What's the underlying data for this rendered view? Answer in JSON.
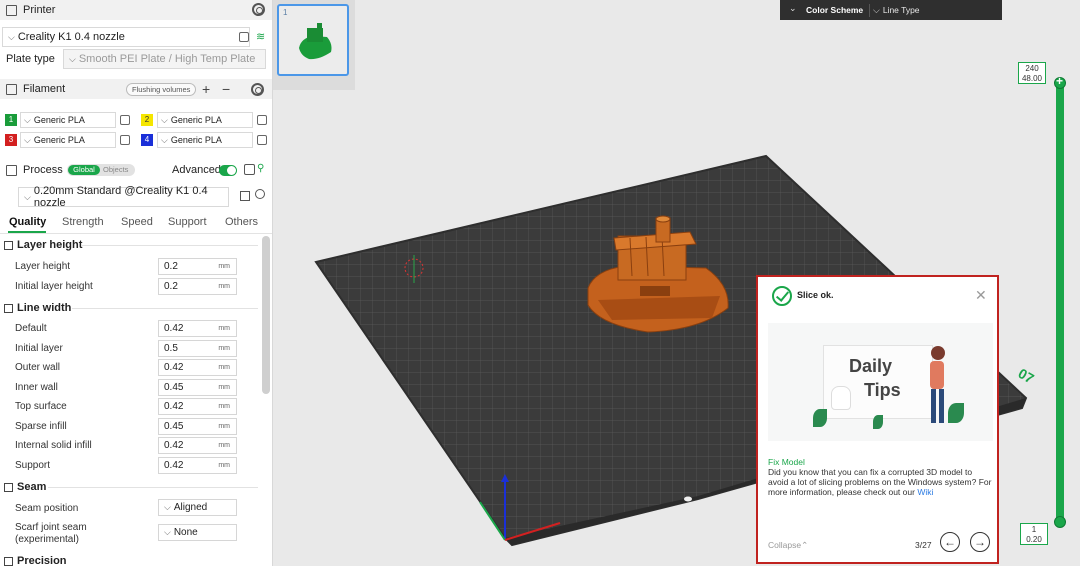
{
  "printer": {
    "title": "Printer",
    "selected_printer": "Creality K1 0.4 nozzle",
    "plate_type_label": "Plate type",
    "plate_type_value": "Smooth PEI Plate / High Temp Plate"
  },
  "filament": {
    "title": "Filament",
    "flushing_volumes_label": "Flushing volumes",
    "add_symbol": "+",
    "remove_symbol": "−",
    "slots": [
      {
        "number": "1",
        "color": "#1a9c3a",
        "name": "Generic PLA"
      },
      {
        "number": "2",
        "color": "#f5e600",
        "name": "Generic PLA"
      },
      {
        "number": "3",
        "color": "#d32020",
        "name": "Generic PLA"
      },
      {
        "number": "4",
        "color": "#1a2fd8",
        "name": "Generic PLA"
      }
    ]
  },
  "process": {
    "title": "Process",
    "scope_global": "Global",
    "scope_objects": "Objects",
    "advanced_label": "Advanced",
    "preset": "0.20mm Standard @Creality K1 0.4 nozzle",
    "tabs": [
      "Quality",
      "Strength",
      "Speed",
      "Support",
      "Others"
    ],
    "groups": {
      "layer_height": {
        "title": "Layer height",
        "rows": [
          {
            "label": "Layer height",
            "value": "0.2",
            "unit": "mm"
          },
          {
            "label": "Initial layer height",
            "value": "0.2",
            "unit": "mm"
          }
        ]
      },
      "line_width": {
        "title": "Line width",
        "rows": [
          {
            "label": "Default",
            "value": "0.42",
            "unit": "mm"
          },
          {
            "label": "Initial layer",
            "value": "0.5",
            "unit": "mm"
          },
          {
            "label": "Outer wall",
            "value": "0.42",
            "unit": "mm"
          },
          {
            "label": "Inner wall",
            "value": "0.45",
            "unit": "mm"
          },
          {
            "label": "Top surface",
            "value": "0.42",
            "unit": "mm"
          },
          {
            "label": "Sparse infill",
            "value": "0.45",
            "unit": "mm"
          },
          {
            "label": "Internal solid infill",
            "value": "0.42",
            "unit": "mm"
          },
          {
            "label": "Support",
            "value": "0.42",
            "unit": "mm"
          }
        ]
      },
      "seam": {
        "title": "Seam",
        "rows": [
          {
            "label": "Seam position",
            "value": "Aligned"
          },
          {
            "label": "Scarf joint seam (experimental)",
            "value": "None"
          }
        ]
      },
      "precision": {
        "title": "Precision"
      }
    }
  },
  "plate": {
    "thumbnail_number": "1"
  },
  "color_scheme": {
    "label": "Color Scheme",
    "value": "Line Type"
  },
  "layer_slider": {
    "top_layer": "240",
    "top_height": "48.00",
    "bottom_layer": "1",
    "bottom_height": "0.20"
  },
  "plate_label": "07",
  "notification": {
    "status": "Slice ok.",
    "tip_image_line1": "Daily",
    "tip_image_line2": "Tips",
    "tip_title": "Fix Model",
    "tip_text": "Did you know that you can fix a corrupted 3D model to avoid a lot of slicing problems on the Windows system? For more information, please check out our",
    "tip_link": "Wiki",
    "collapse_label": "Collapse",
    "collapse_symbol": "⌃",
    "page": "3/27",
    "prev_symbol": "←",
    "next_symbol": "→",
    "close_symbol": "✕"
  },
  "colors": {
    "accent": "#1aa64a",
    "plate": "#3b3b3b",
    "model": "#c4611d",
    "highlight_border": "#c0221f"
  }
}
